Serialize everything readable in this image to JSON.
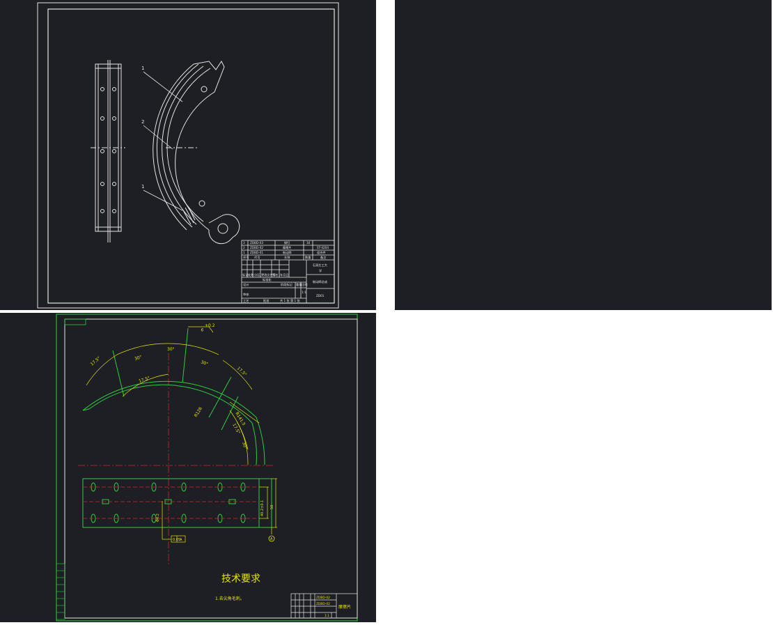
{
  "colors": {
    "background": "#1d1f24",
    "page": "#ffffff",
    "line_white": "#e6e6e6",
    "line_green": "#2ecc40",
    "line_yellow": "#e6e600",
    "line_red": "#e02020"
  },
  "drawing1": {
    "balloons": [
      "1",
      "2",
      "1"
    ],
    "title_block": {
      "parts": [
        {
          "seq": "3",
          "code": "ZDBD-03",
          "name": "铆钉",
          "qty": "16",
          "material": ""
        },
        {
          "seq": "2",
          "code": "ZDBD-02",
          "name": "摩擦片",
          "qty": "",
          "material": "ST-4204"
        },
        {
          "seq": "1",
          "code": "ZDBD-01",
          "name": "制动蹄",
          "qty": "",
          "material": "组合件"
        }
      ],
      "header": {
        "seq": "序号",
        "code": "代号",
        "name": "名称",
        "qty": "数量",
        "note": "备注"
      },
      "university": "石家庄工大",
      "dept": "学",
      "drawing_name": "制动蹄总成",
      "drawing_no": "ZD01",
      "labels": {
        "mark": "标记",
        "count": "处数",
        "zone": "分区",
        "change_doc": "更改文件号",
        "signature": "签名",
        "date": "年月日",
        "design": "设计",
        "standard": "标准化",
        "stage": "阶段标记",
        "weight": "重量",
        "scale": "比例",
        "scale_value": "1:1",
        "review": "审核",
        "process": "工艺",
        "approve": "批准",
        "sheet_info": "共 1 张 第 1 张"
      }
    }
  },
  "drawing2": {
    "dims": {
      "arc_a": "17.5°",
      "arc_b": "30°",
      "arc_c": "30°",
      "arc_d": "30°",
      "arc_e": "17.5°",
      "arc_f": "17.5°",
      "arc_g": "30°",
      "arc_h": "17.5°",
      "radius_a": "R126",
      "radius_b": "R141.5",
      "width_a": "6",
      "tol": "+0.2",
      "h1": "40.2±0.1",
      "h2": "50",
      "hole": "Φ4.2",
      "datum": "A",
      "frame_a": "0.05",
      "frame_b": "A"
    },
    "tech_title": "技术要求",
    "tech_note": "1.去尖角毛刺。",
    "title_block": {
      "rows": [
        "ZDBD-02",
        "ZDBD-02"
      ],
      "name": "摩擦片",
      "label_small": "1:1"
    }
  }
}
